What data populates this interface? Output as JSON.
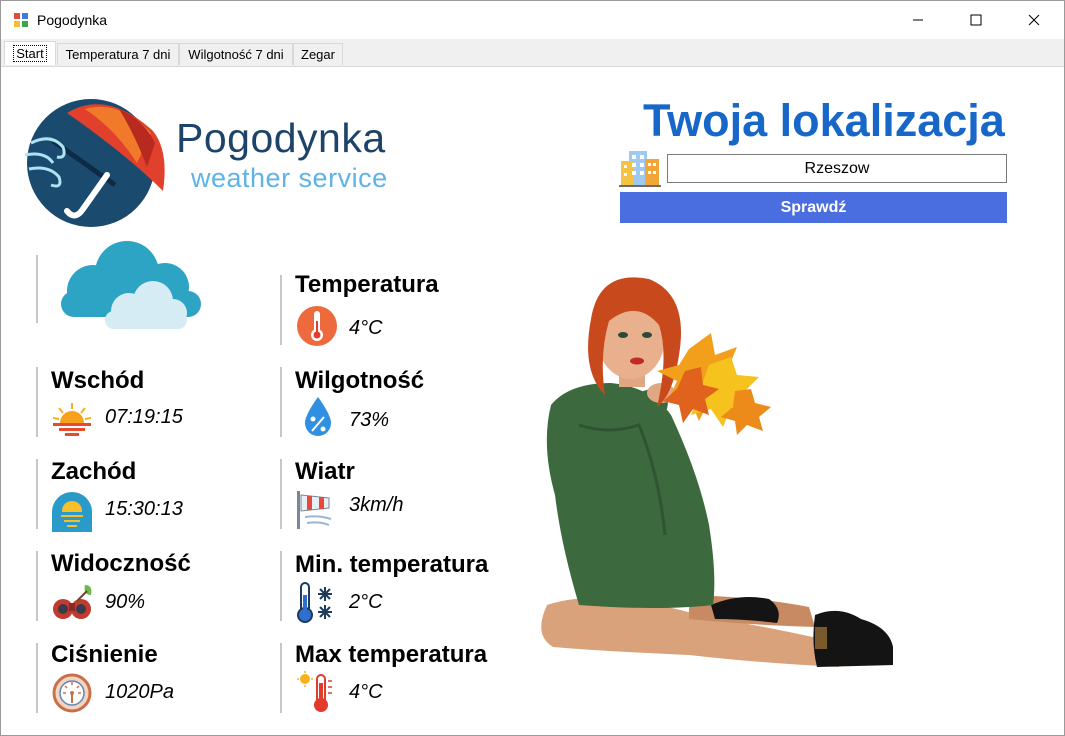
{
  "window": {
    "title": "Pogodynka"
  },
  "tabs": [
    {
      "label": "Start"
    },
    {
      "label": "Temperatura 7 dni"
    },
    {
      "label": "Wilgotność 7 dni"
    },
    {
      "label": "Zegar"
    }
  ],
  "brand": {
    "name": "Pogodynka",
    "subtitle": "weather service"
  },
  "location": {
    "title": "Twoja lokalizacja",
    "city_value": "Rzeszow",
    "check_label": "Sprawdź"
  },
  "stats": {
    "temperature": {
      "label": "Temperatura",
      "value": "4°C"
    },
    "sunrise": {
      "label": "Wschód",
      "value": "07:19:15"
    },
    "humidity": {
      "label": "Wilgotność",
      "value": "73%"
    },
    "sunset": {
      "label": "Zachód",
      "value": "15:30:13"
    },
    "wind": {
      "label": "Wiatr",
      "value": "3km/h"
    },
    "visibility": {
      "label": "Widoczność",
      "value": "90%"
    },
    "min_temp": {
      "label": "Min. temperatura",
      "value": "2°C"
    },
    "pressure": {
      "label": "Ciśnienie",
      "value": "1020Pa"
    },
    "max_temp": {
      "label": "Max temperatura",
      "value": "4°C"
    }
  },
  "colors": {
    "accent": "#4a6ee0",
    "title_blue": "#1767c9",
    "brand_dark": "#1d4468",
    "brand_light": "#5fb3e6"
  }
}
